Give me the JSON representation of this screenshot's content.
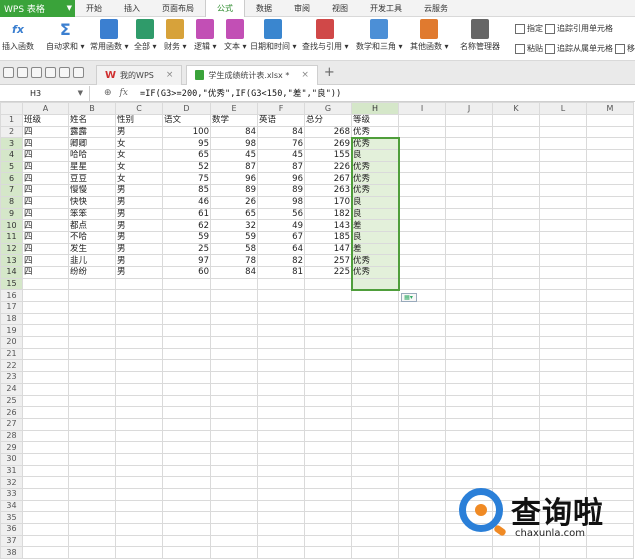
{
  "menubar": {
    "app_label": "WPS 表格",
    "tabs": [
      "开始",
      "插入",
      "页面布局",
      "公式",
      "数据",
      "审阅",
      "视图",
      "开发工具",
      "云服务"
    ],
    "active_tab": "公式"
  },
  "ribbon": {
    "buttons": [
      {
        "label": "插入函数",
        "icon": "fx-icon"
      },
      {
        "label": "自动求和 ▾",
        "icon": "sigma-icon"
      },
      {
        "label": "常用函数 ▾",
        "icon": "common-func-icon"
      },
      {
        "label": "全部 ▾",
        "icon": "all-func-icon"
      },
      {
        "label": "财务 ▾",
        "icon": "finance-icon"
      },
      {
        "label": "逻辑 ▾",
        "icon": "logic-icon"
      },
      {
        "label": "文本 ▾",
        "icon": "text-icon"
      },
      {
        "label": "日期和时间 ▾",
        "icon": "datetime-icon"
      },
      {
        "label": "查找与引用 ▾",
        "icon": "lookup-icon"
      },
      {
        "label": "数学和三角 ▾",
        "icon": "math-icon"
      },
      {
        "label": "其他函数 ▾",
        "icon": "other-func-icon"
      },
      {
        "label": "名称管理器",
        "icon": "name-manager-icon"
      }
    ],
    "small_buttons": [
      "指定",
      "粘贴",
      "追踪引用单元格",
      "追踪从属单元格",
      "移去"
    ]
  },
  "doc_tabs": {
    "home_label": "我的WPS",
    "file_label": "学生成绩统计表.xlsx *",
    "close_glyph": "×",
    "new_glyph": "+"
  },
  "formula_bar": {
    "cell_ref": "H3",
    "fx_label": "fx",
    "formula": "=IF(G3>=200,\"优秀\",IF(G3<150,\"差\",\"良\"))"
  },
  "sheet": {
    "columns": [
      "A",
      "B",
      "C",
      "D",
      "E",
      "F",
      "G",
      "H",
      "I",
      "J",
      "K",
      "L",
      "M"
    ],
    "rows": [
      [
        "班级",
        "姓名",
        "性别",
        "语文",
        "数学",
        "英语",
        "总分",
        "等级",
        "",
        "",
        "",
        "",
        ""
      ],
      [
        "四",
        "露露",
        "男",
        "100",
        "84",
        "84",
        "268",
        "优秀",
        "",
        "",
        "",
        "",
        ""
      ],
      [
        "四",
        "卿卿",
        "女",
        "95",
        "98",
        "76",
        "269",
        "优秀",
        "",
        "",
        "",
        "",
        ""
      ],
      [
        "四",
        "哈哈",
        "女",
        "65",
        "45",
        "45",
        "155",
        "良",
        "",
        "",
        "",
        "",
        ""
      ],
      [
        "四",
        "星星",
        "女",
        "52",
        "87",
        "87",
        "226",
        "优秀",
        "",
        "",
        "",
        "",
        ""
      ],
      [
        "四",
        "豆豆",
        "女",
        "75",
        "96",
        "96",
        "267",
        "优秀",
        "",
        "",
        "",
        "",
        ""
      ],
      [
        "四",
        "慢慢",
        "男",
        "85",
        "89",
        "89",
        "263",
        "优秀",
        "",
        "",
        "",
        "",
        ""
      ],
      [
        "四",
        "快快",
        "男",
        "46",
        "26",
        "98",
        "170",
        "良",
        "",
        "",
        "",
        "",
        ""
      ],
      [
        "四",
        "笨笨",
        "男",
        "61",
        "65",
        "56",
        "182",
        "良",
        "",
        "",
        "",
        "",
        ""
      ],
      [
        "四",
        "都点",
        "男",
        "62",
        "32",
        "49",
        "143",
        "差",
        "",
        "",
        "",
        "",
        ""
      ],
      [
        "四",
        "不哈",
        "男",
        "59",
        "59",
        "67",
        "185",
        "良",
        "",
        "",
        "",
        "",
        ""
      ],
      [
        "四",
        "发生",
        "男",
        "25",
        "58",
        "64",
        "147",
        "差",
        "",
        "",
        "",
        "",
        ""
      ],
      [
        "四",
        "韭儿",
        "男",
        "97",
        "78",
        "82",
        "257",
        "优秀",
        "",
        "",
        "",
        "",
        ""
      ],
      [
        "四",
        "纷纷",
        "男",
        "60",
        "84",
        "81",
        "225",
        "优秀",
        "",
        "",
        "",
        "",
        ""
      ]
    ],
    "total_rows": 38,
    "selected_column": "H",
    "selected_rows": [
      3,
      15
    ]
  },
  "watermark": {
    "title": "查询啦",
    "url": "chaxunla.com"
  },
  "colors": {
    "app_green": "#3aa33a",
    "selection": "#4f9e3b",
    "selection_fill": "#e3f0da"
  }
}
